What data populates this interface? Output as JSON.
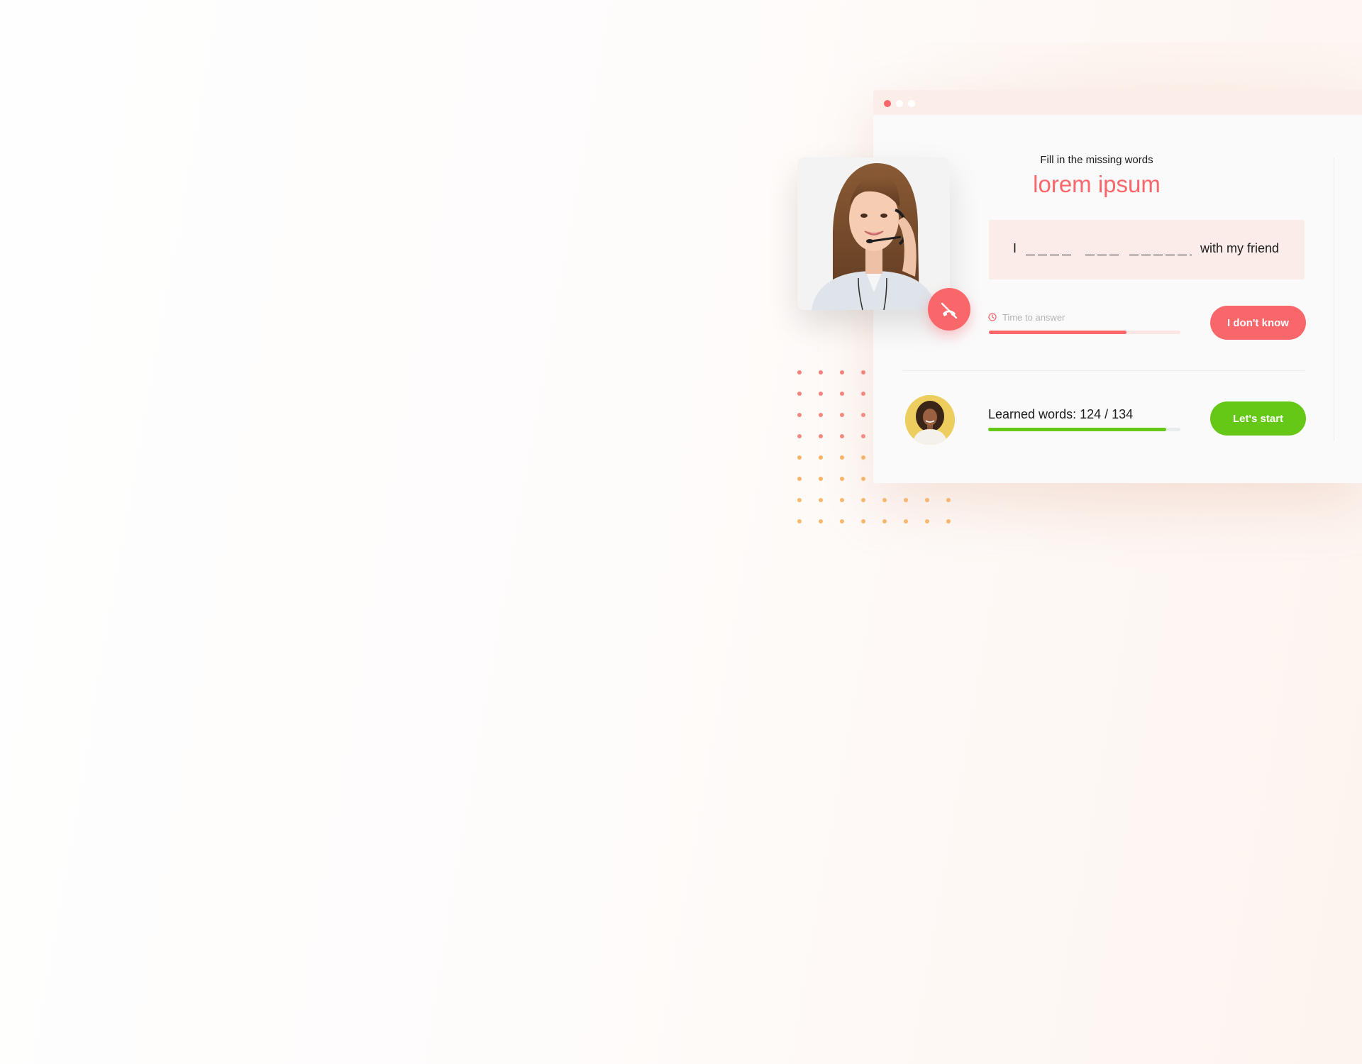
{
  "exercise": {
    "instruction": "Fill in the missing words",
    "heading": "lorem ipsum",
    "sentence": {
      "start": "I",
      "end": "with my friend"
    },
    "timer": {
      "label": "Time to answer",
      "remaining_fraction": 0.72
    },
    "dont_know_label": "I don't know"
  },
  "learned": {
    "label": "Learned words: 124 / 134",
    "learned": 124,
    "total": 134,
    "start_label": "Let's start"
  },
  "colors": {
    "accent": "#f9676b",
    "success": "#65c816",
    "sentence_bg": "#fbece9"
  },
  "icons": {
    "call": "end-call-icon",
    "timer": "clock-icon"
  }
}
